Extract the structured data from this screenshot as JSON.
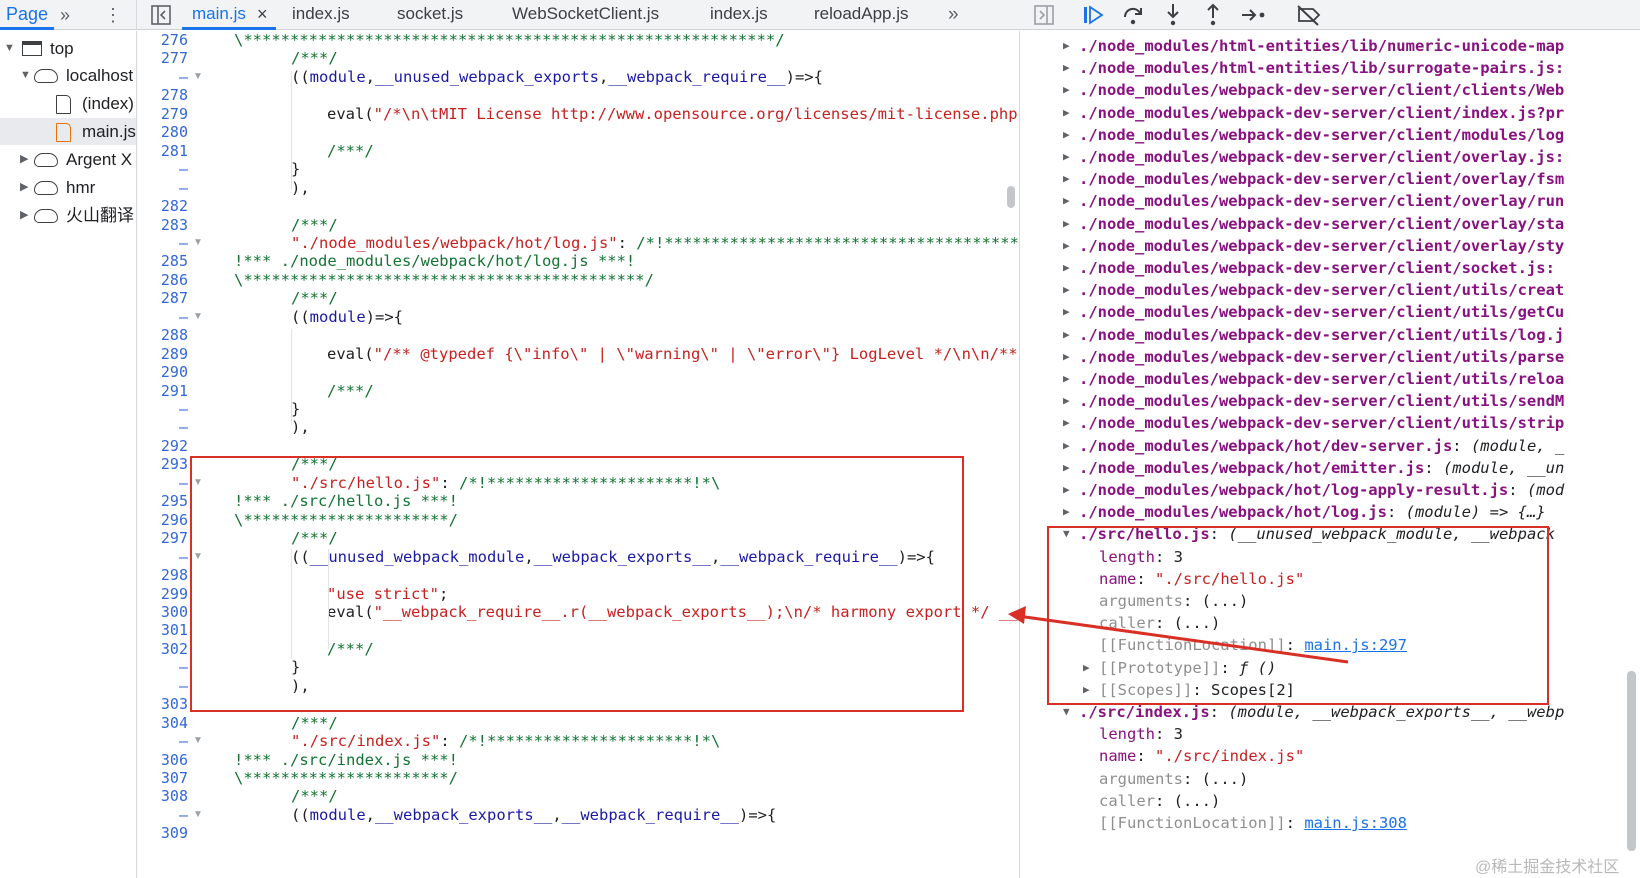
{
  "topbar": {
    "page_label": "Page",
    "more_tabs": "»",
    "kebab": "⋮",
    "file_tabs": [
      {
        "label": "main.js",
        "active": true,
        "closable": true
      },
      {
        "label": "index.js"
      },
      {
        "label": "socket.js"
      },
      {
        "label": "WebSocketClient.js"
      },
      {
        "label": "index.js"
      },
      {
        "label": "reloadApp.js"
      }
    ],
    "overflow": "»",
    "close_glyph": "×"
  },
  "navigator": [
    {
      "label": "top",
      "icon": "frame-icon",
      "expanded": true,
      "depth": 0
    },
    {
      "label": "localhost",
      "icon": "cloud-icon",
      "expanded": true,
      "depth": 1
    },
    {
      "label": "(index)",
      "icon": "file-icon",
      "depth": 2
    },
    {
      "label": "main.js",
      "icon": "file-icon-orange",
      "depth": 2,
      "selected": true
    },
    {
      "label": "Argent X",
      "icon": "cloud-icon",
      "expanded": false,
      "depth": 1
    },
    {
      "label": "hmr",
      "icon": "cloud-icon",
      "expanded": false,
      "depth": 1
    },
    {
      "label": "火山翻译",
      "icon": "cloud-icon",
      "expanded": false,
      "depth": 1
    }
  ],
  "editor": {
    "lines": [
      {
        "n": "276",
        "segs": [
          [
            "c-com",
            "\\*********************************************************/"
          ]
        ],
        "indent": 0
      },
      {
        "n": "277",
        "segs": [
          [
            "c-com",
            "/***/"
          ]
        ],
        "indent": 1
      },
      {
        "n": "–",
        "fold": true,
        "segs": [
          [
            "",
            "(("
          ],
          [
            "c-var",
            "module"
          ],
          [
            "",
            ","
          ],
          [
            "c-var",
            "__unused_webpack_exports"
          ],
          [
            "",
            ","
          ],
          [
            "c-var",
            "__webpack_require__"
          ],
          [
            "",
            ")=>{"
          ]
        ],
        "indent": 1
      },
      {
        "n": "278",
        "segs": [],
        "indent": 0
      },
      {
        "n": "279",
        "segs": [
          [
            "",
            "eval("
          ],
          [
            "c-str",
            "\"/*\\n\\tMIT License http://www.opensource.org/licenses/mit-license.php"
          ]
        ],
        "indent": 2
      },
      {
        "n": "280",
        "segs": [],
        "indent": 0
      },
      {
        "n": "281",
        "segs": [
          [
            "c-com",
            "/***/"
          ]
        ],
        "indent": 2
      },
      {
        "n": "–",
        "segs": [
          [
            "",
            "}"
          ]
        ],
        "indent": 1
      },
      {
        "n": "–",
        "segs": [
          [
            "",
            "),"
          ]
        ],
        "indent": 1
      },
      {
        "n": "282",
        "segs": [],
        "indent": 0
      },
      {
        "n": "283",
        "segs": [
          [
            "c-com",
            "/***/"
          ]
        ],
        "indent": 1
      },
      {
        "n": "–",
        "fold": true,
        "segs": [
          [
            "c-str",
            "\"./node_modules/webpack/hot/log.js\""
          ],
          [
            "",
            ": "
          ],
          [
            "c-com",
            "/*!*************************************************"
          ]
        ],
        "indent": 1
      },
      {
        "n": "285",
        "segs": [
          [
            "c-com",
            "!*** ./node_modules/webpack/hot/log.js ***!"
          ]
        ],
        "indent": 0
      },
      {
        "n": "286",
        "segs": [
          [
            "c-com",
            "\\*******************************************/"
          ]
        ],
        "indent": 0
      },
      {
        "n": "287",
        "segs": [
          [
            "c-com",
            "/***/"
          ]
        ],
        "indent": 1
      },
      {
        "n": "–",
        "fold": true,
        "segs": [
          [
            "",
            "(("
          ],
          [
            "c-var",
            "module"
          ],
          [
            "",
            ")=>{"
          ]
        ],
        "indent": 1
      },
      {
        "n": "288",
        "segs": [],
        "indent": 0
      },
      {
        "n": "289",
        "segs": [
          [
            "",
            "eval("
          ],
          [
            "c-str",
            "\"/** @typedef {\\\"info\\\" | \\\"warning\\\" | \\\"error\\\"} LogLevel */\\n\\n/**"
          ]
        ],
        "indent": 2
      },
      {
        "n": "290",
        "segs": [],
        "indent": 0
      },
      {
        "n": "291",
        "segs": [
          [
            "c-com",
            "/***/"
          ]
        ],
        "indent": 2
      },
      {
        "n": "–",
        "segs": [
          [
            "",
            "}"
          ]
        ],
        "indent": 1
      },
      {
        "n": "–",
        "segs": [
          [
            "",
            "),"
          ]
        ],
        "indent": 1
      },
      {
        "n": "292",
        "segs": [],
        "indent": 0
      },
      {
        "n": "293",
        "segs": [
          [
            "c-com",
            "/***/"
          ]
        ],
        "indent": 1
      },
      {
        "n": "–",
        "fold": true,
        "segs": [
          [
            "c-str",
            "\"./src/hello.js\""
          ],
          [
            "",
            ": "
          ],
          [
            "c-com",
            "/*!**********************!*\\"
          ]
        ],
        "indent": 1
      },
      {
        "n": "295",
        "segs": [
          [
            "c-com",
            "!*** ./src/hello.js ***!"
          ]
        ],
        "indent": 0
      },
      {
        "n": "296",
        "segs": [
          [
            "c-com",
            "\\**********************/"
          ]
        ],
        "indent": 0
      },
      {
        "n": "297",
        "segs": [
          [
            "c-com",
            "/***/"
          ]
        ],
        "indent": 1
      },
      {
        "n": "–",
        "fold": true,
        "segs": [
          [
            "",
            "(("
          ],
          [
            "c-var",
            "__unused_webpack_module"
          ],
          [
            "",
            ","
          ],
          [
            "c-var",
            "__webpack_exports__"
          ],
          [
            "",
            ","
          ],
          [
            "c-var",
            "__webpack_require__"
          ],
          [
            "",
            ")=>{"
          ]
        ],
        "indent": 1
      },
      {
        "n": "298",
        "segs": [],
        "indent": 0
      },
      {
        "n": "299",
        "segs": [
          [
            "c-str",
            "\"use strict\""
          ],
          [
            "",
            ";"
          ]
        ],
        "indent": 2
      },
      {
        "n": "300",
        "segs": [
          [
            "",
            "eval("
          ],
          [
            "c-str",
            "\"__webpack_require__.r(__webpack_exports__);\\n/* harmony export */ __"
          ]
        ],
        "indent": 2
      },
      {
        "n": "301",
        "segs": [],
        "indent": 0
      },
      {
        "n": "302",
        "segs": [
          [
            "c-com",
            "/***/"
          ]
        ],
        "indent": 2
      },
      {
        "n": "–",
        "segs": [
          [
            "",
            "}"
          ]
        ],
        "indent": 1
      },
      {
        "n": "–",
        "segs": [
          [
            "",
            "),"
          ]
        ],
        "indent": 1
      },
      {
        "n": "303",
        "segs": [],
        "indent": 0
      },
      {
        "n": "304",
        "segs": [
          [
            "c-com",
            "/***/"
          ]
        ],
        "indent": 1
      },
      {
        "n": "–",
        "fold": true,
        "segs": [
          [
            "c-str",
            "\"./src/index.js\""
          ],
          [
            "",
            ": "
          ],
          [
            "c-com",
            "/*!**********************!*\\"
          ]
        ],
        "indent": 1
      },
      {
        "n": "306",
        "segs": [
          [
            "c-com",
            "!*** ./src/index.js ***!"
          ]
        ],
        "indent": 0
      },
      {
        "n": "307",
        "segs": [
          [
            "c-com",
            "\\**********************/"
          ]
        ],
        "indent": 0
      },
      {
        "n": "308",
        "segs": [
          [
            "c-com",
            "/***/"
          ]
        ],
        "indent": 1
      },
      {
        "n": "–",
        "fold": true,
        "segs": [
          [
            "",
            "(("
          ],
          [
            "c-var",
            "module"
          ],
          [
            "",
            ","
          ],
          [
            "c-var",
            "__webpack_exports__"
          ],
          [
            "",
            ","
          ],
          [
            "c-var",
            "__webpack_require__"
          ],
          [
            "",
            ")=>{"
          ]
        ],
        "indent": 1
      },
      {
        "n": "309",
        "segs": [],
        "indent": 0
      }
    ]
  },
  "scope": {
    "modules": [
      "./node_modules/html-entities/lib/numeric-unicode-map",
      "./node_modules/html-entities/lib/surrogate-pairs.js:",
      "./node_modules/webpack-dev-server/client/clients/Web",
      "./node_modules/webpack-dev-server/client/index.js?pr",
      "./node_modules/webpack-dev-server/client/modules/log",
      "./node_modules/webpack-dev-server/client/overlay.js:",
      "./node_modules/webpack-dev-server/client/overlay/fsm",
      "./node_modules/webpack-dev-server/client/overlay/run",
      "./node_modules/webpack-dev-server/client/overlay/sta",
      "./node_modules/webpack-dev-server/client/overlay/sty",
      "./node_modules/webpack-dev-server/client/socket.js:",
      "./node_modules/webpack-dev-server/client/utils/creat",
      "./node_modules/webpack-dev-server/client/utils/getCu",
      "./node_modules/webpack-dev-server/client/utils/log.j",
      "./node_modules/webpack-dev-server/client/utils/parse",
      "./node_modules/webpack-dev-server/client/utils/reloa",
      "./node_modules/webpack-dev-server/client/utils/sendM",
      "./node_modules/webpack-dev-server/client/utils/strip"
    ],
    "fn_modules": [
      {
        "key": "./node_modules/webpack/hot/dev-server.js",
        "sig": " (module, _"
      },
      {
        "key": "./node_modules/webpack/hot/emitter.js",
        "sig": " (module, __un"
      },
      {
        "key": "./node_modules/webpack/hot/log-apply-result.js",
        "sig": " (mod"
      },
      {
        "key": "./node_modules/webpack/hot/log.js",
        "sig": " (module) => {…}"
      }
    ],
    "hello": {
      "key": "./src/hello.js",
      "sig": " (__unused_webpack_module, __webpack",
      "length_key": "length",
      "length_val": "3",
      "name_key": "name",
      "name_val": "\"./src/hello.js\"",
      "arguments_key": "arguments",
      "arguments_val": "(...)",
      "caller_key": "caller",
      "caller_val": "(...)",
      "floc_key": "[[FunctionLocation]]",
      "floc_val": "main.js:297",
      "proto_key": "[[Prototype]]",
      "proto_val": "ƒ ()",
      "scopes_key": "[[Scopes]]",
      "scopes_val": "Scopes[2]"
    },
    "index": {
      "key": "./src/index.js",
      "sig": " (module, __webpack_exports__, __webp",
      "length_key": "length",
      "length_val": "3",
      "name_key": "name",
      "name_val": "\"./src/index.js\"",
      "arguments_key": "arguments",
      "arguments_val": "(...)",
      "caller_key": "caller",
      "caller_val": "(...)",
      "floc_key": "[[FunctionLocation]]",
      "floc_val": "main.js:308"
    }
  },
  "watermark": "@稀土掘金技术社区",
  "colors": {
    "accent": "#1a73e8",
    "annotation": "#d93025"
  }
}
